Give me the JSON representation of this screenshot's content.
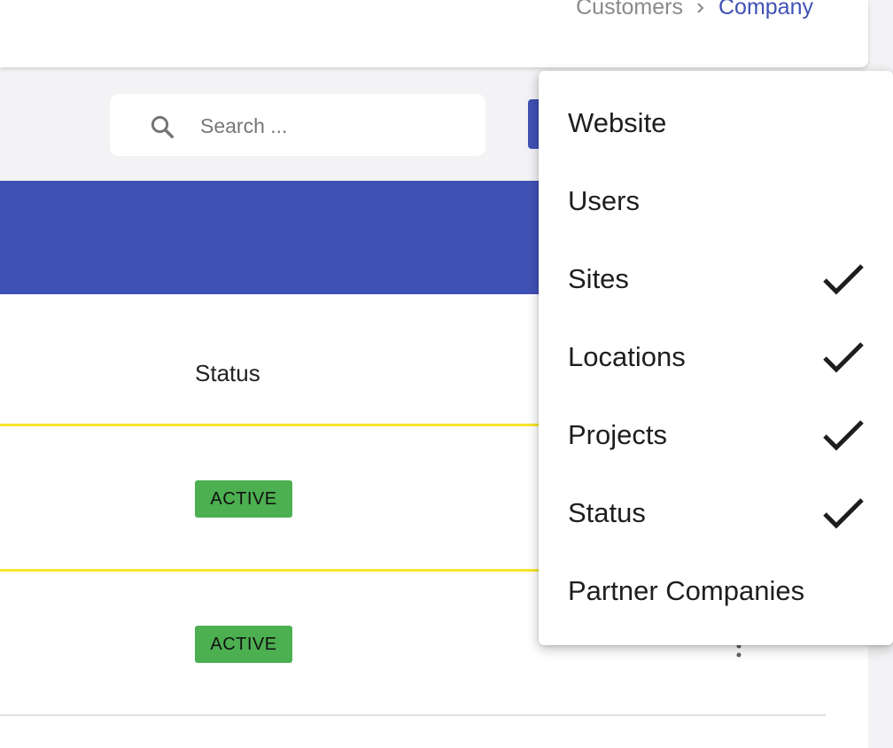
{
  "breadcrumb": {
    "parent": "Customers",
    "current": "Company"
  },
  "search": {
    "placeholder": "Search ..."
  },
  "table": {
    "column_header": "Status",
    "rows": [
      {
        "status": "ACTIVE"
      },
      {
        "status": "ACTIVE"
      }
    ]
  },
  "column_menu": {
    "items": [
      {
        "label": "Website",
        "checked": false
      },
      {
        "label": "Users",
        "checked": false
      },
      {
        "label": "Sites",
        "checked": true
      },
      {
        "label": "Locations",
        "checked": true
      },
      {
        "label": "Projects",
        "checked": true
      },
      {
        "label": "Status",
        "checked": true
      },
      {
        "label": "Partner Companies",
        "checked": false
      }
    ]
  },
  "colors": {
    "primary": "#3f51b5",
    "active_badge": "#4caf50",
    "row_highlight": "#f7e52d"
  },
  "icons": {
    "search": "search-icon",
    "breadcrumb_separator": "chevron-right-icon",
    "check": "check-icon",
    "row_menu": "more-vert-icon"
  }
}
